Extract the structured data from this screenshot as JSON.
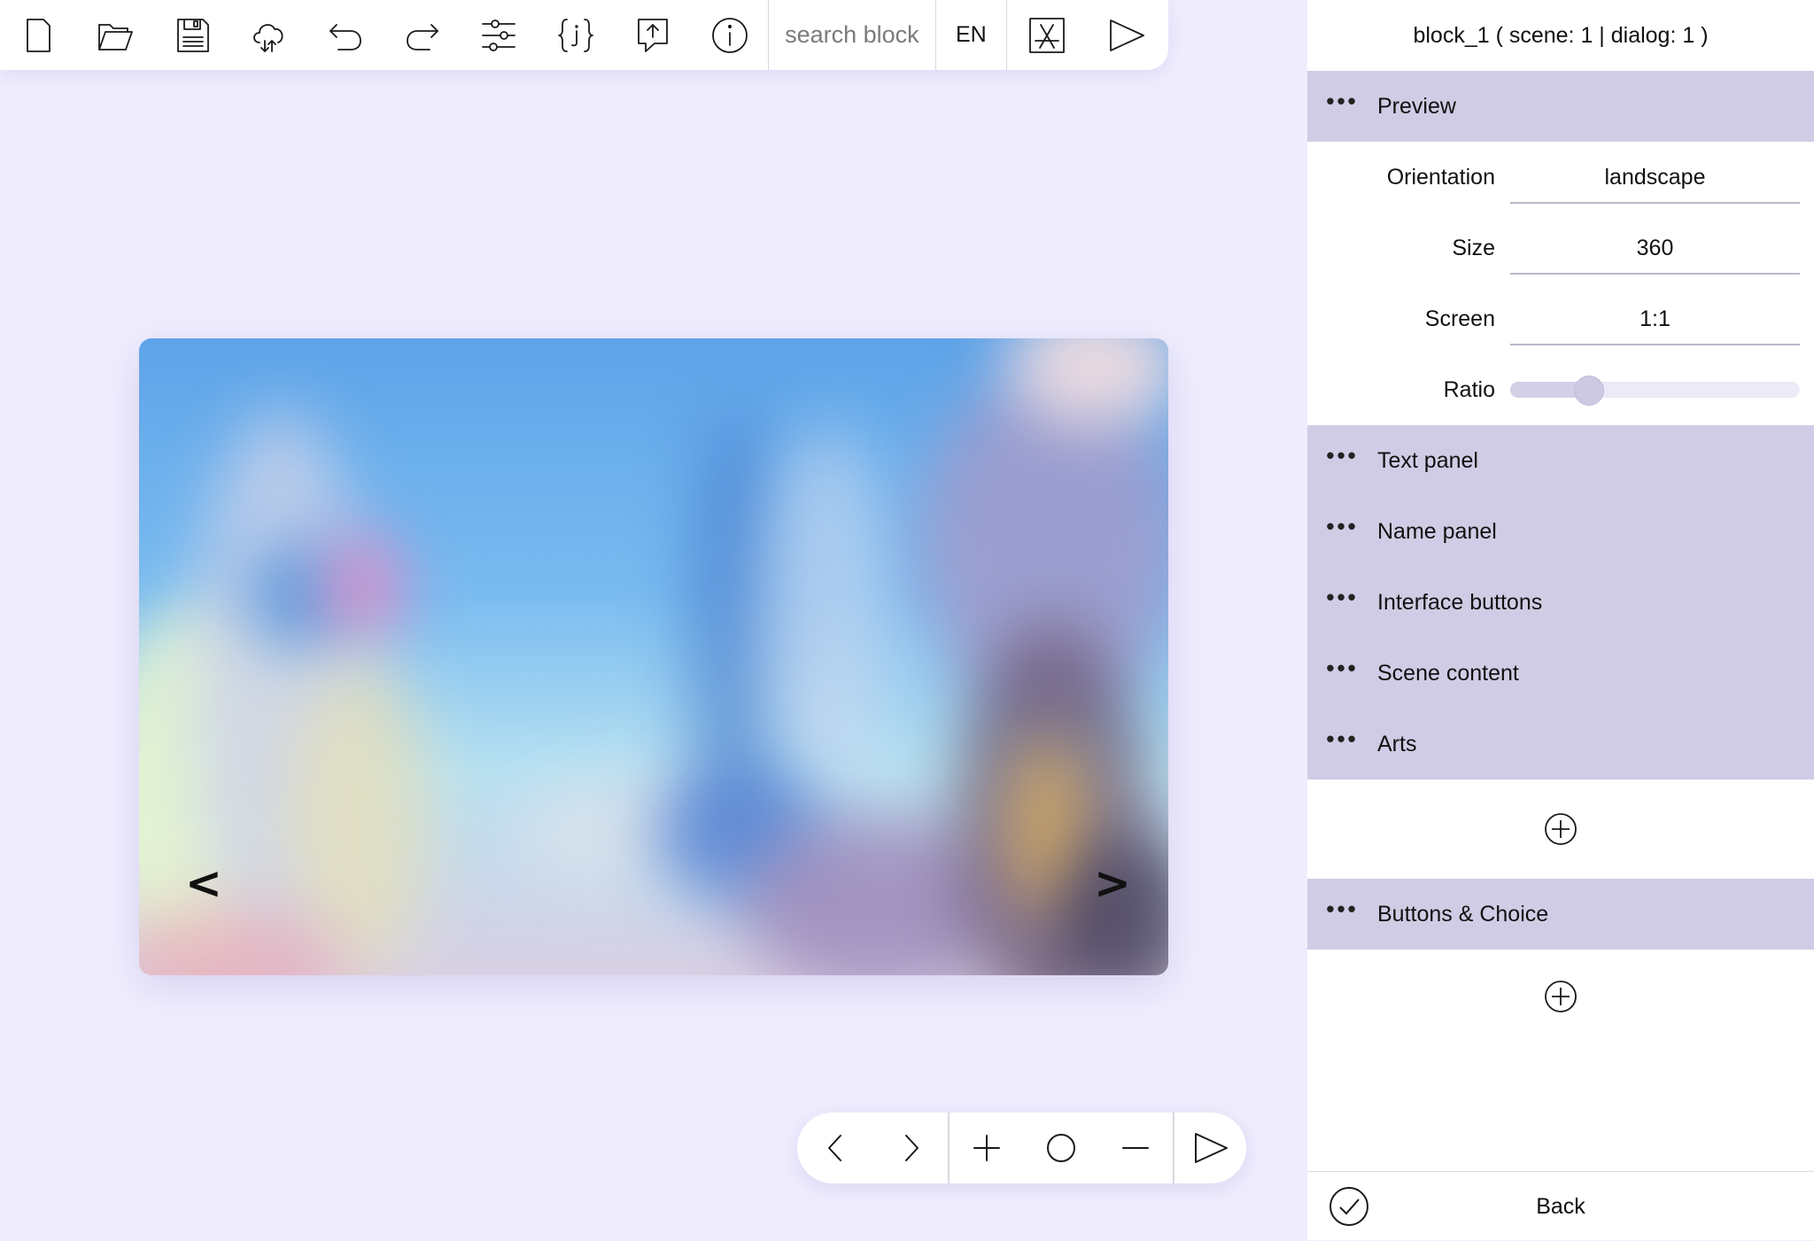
{
  "toolbar": {
    "buttons": [
      {
        "icon": "new-file-icon"
      },
      {
        "icon": "open-folder-icon"
      },
      {
        "icon": "save-icon"
      },
      {
        "icon": "cloud-sync-icon"
      },
      {
        "icon": "undo-icon"
      },
      {
        "icon": "redo-icon"
      },
      {
        "icon": "settings-sliders-icon"
      },
      {
        "icon": "json-icon"
      },
      {
        "icon": "export-icon"
      },
      {
        "icon": "info-icon"
      }
    ],
    "search_placeholder": "search block",
    "language": "EN",
    "extra_buttons": [
      {
        "icon": "app-store-icon"
      },
      {
        "icon": "play-icon"
      }
    ]
  },
  "preview": {
    "prev_arrow": "<",
    "next_arrow": ">"
  },
  "bottom_bar": {
    "buttons": [
      {
        "icon": "chevron-left-icon"
      },
      {
        "icon": "chevron-right-icon"
      },
      {
        "icon": "zoom-in-icon"
      },
      {
        "icon": "reset-zoom-icon"
      },
      {
        "icon": "zoom-out-icon"
      },
      {
        "icon": "play-icon"
      }
    ]
  },
  "panel": {
    "title": "block_1 ( scene: 1 | dialog: 1 )",
    "preview_section": {
      "label": "Preview",
      "dots": "•••",
      "properties": {
        "orientation": {
          "label": "Orientation",
          "value": "landscape"
        },
        "size": {
          "label": "Size",
          "value": "360"
        },
        "screen": {
          "label": "Screen",
          "value": "1:1"
        },
        "ratio": {
          "label": "Ratio",
          "value": 0.27
        }
      }
    },
    "sections": [
      {
        "label": "Text panel",
        "dots": "•••"
      },
      {
        "label": "Name panel",
        "dots": "•••"
      },
      {
        "label": "Interface buttons",
        "dots": "•••"
      },
      {
        "label": "Scene content",
        "dots": "•••"
      },
      {
        "label": "Arts",
        "dots": "•••"
      }
    ],
    "buttons_section": {
      "label": "Buttons & Choice",
      "dots": "•••"
    },
    "footer": {
      "back_label": "Back"
    },
    "colors": {
      "section_bg": "#d1cce5",
      "page_bg": "#efedfd",
      "accent": "#cdc9e3"
    }
  }
}
